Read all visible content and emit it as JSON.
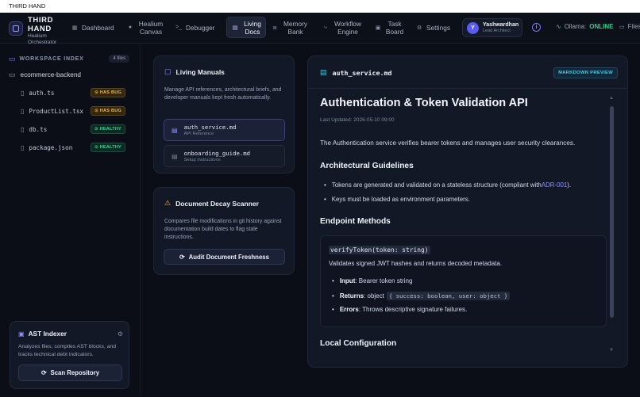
{
  "window": {
    "title": "THIRD HAND"
  },
  "brand": {
    "name": "THIRD HAND",
    "subtitle_line1": "Healium",
    "subtitle_line2": "Orchestrator"
  },
  "nav": {
    "items": [
      {
        "label": "Dashboard",
        "icon": "grid-icon"
      },
      {
        "label": "Healium Canvas",
        "icon": "node-icon"
      },
      {
        "label": "Debugger",
        "icon": "terminal-icon"
      },
      {
        "label": "Living Docs",
        "icon": "doc-icon",
        "active": true
      },
      {
        "label": "Memory Bank",
        "icon": "database-icon"
      },
      {
        "label": "Workflow Engine",
        "icon": "workflow-icon"
      },
      {
        "label": "Task Board",
        "icon": "board-icon"
      },
      {
        "label": "Settings",
        "icon": "gear-icon"
      }
    ]
  },
  "user": {
    "initial": "Y",
    "name": "Yashwardhan",
    "role": "Lead Architect"
  },
  "status": {
    "label": "Ollama:",
    "value": "ONLINE",
    "color": "#2fd18b"
  },
  "files_link": {
    "label": "Files"
  },
  "workspace": {
    "title": "WORKSPACE INDEX",
    "count": "4 files",
    "root": "ecommerce-backend",
    "files": [
      {
        "name": "auth.ts",
        "badge": "HAS BUG",
        "status": "bug"
      },
      {
        "name": "ProductList.tsx",
        "badge": "HAS BUG",
        "status": "bug"
      },
      {
        "name": "db.ts",
        "badge": "HEALTHY",
        "status": "healthy"
      },
      {
        "name": "package.json",
        "badge": "HEALTHY",
        "status": "healthy"
      }
    ]
  },
  "ast": {
    "title": "AST Indexer",
    "description": "Analyzes files, compiles AST blocks, and tracks technical debt indicators.",
    "button": "Scan Repository"
  },
  "manuals": {
    "title": "Living Manuals",
    "description": "Manage API references, architectural briefs, and developer manuals kept fresh automatically.",
    "docs": [
      {
        "name": "auth_service.md",
        "subtitle": "API Reference"
      },
      {
        "name": "onboarding_guide.md",
        "subtitle": "Setup instructions"
      }
    ]
  },
  "scanner": {
    "title": "Document Decay Scanner",
    "description": "Compares file modifications in git history against documentation build dates to flag stale instructions.",
    "button": "Audit Document Freshness"
  },
  "document": {
    "filename": "auth_service.md",
    "mode_badge": "MARKDOWN PREVIEW",
    "title": "Authentication & Token Validation API",
    "updated": "Last Updated: 2026-05-10 09:00",
    "intro": "The Authentication service verifies bearer tokens and manages user security clearances.",
    "h_guidelines": "Architectural Guidelines",
    "guideline_1_text": "Tokens are generated and validated on a stateless structure (compliant with ",
    "guideline_1_link": "ADR-001",
    "guideline_1_end": ").",
    "guideline_2": "Keys must be loaded as environment parameters.",
    "h_endpoints": "Endpoint Methods",
    "signature": "verifyToken(token: string)",
    "signature_desc": "Validates signed JWT hashes and returns decoded metadata.",
    "input_label": "Input",
    "input_text": ": Bearer token string",
    "returns_label": "Returns",
    "returns_text": ": object",
    "returns_code": "{ success: boolean, user: object }",
    "errors_label": "Errors",
    "errors_text": ": Throws descriptive signature failures.",
    "h_config": "Local Configuration"
  }
}
